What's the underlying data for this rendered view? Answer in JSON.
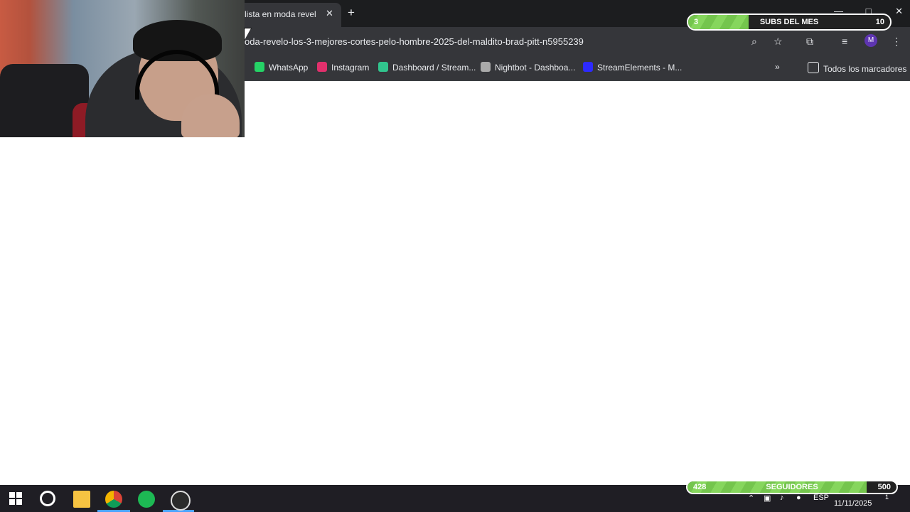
{
  "browser": {
    "tab_title": "lista en moda reveló",
    "url": "oda-revelo-los-3-mejores-cortes-pelo-hombre-2025-del-maldito-brad-pitt-n5955239",
    "avatar_letter": "M",
    "bookmarks": [
      "WhatsApp",
      "Instagram",
      "Dashboard / Stream...",
      "Nightbot - Dashboa...",
      "StreamElements - M..."
    ],
    "all_bookmarks": "Todos los marcadores"
  },
  "overlays": {
    "subs": {
      "current": "3",
      "title": "SUBS DEL MES",
      "goal": "10",
      "progress_fraction": 0.3
    },
    "followers": {
      "current": "428",
      "title": "SEGUIDORES",
      "goal": "500",
      "progress_fraction": 0.856
    }
  },
  "taskbar": {
    "language": "ESP",
    "date": "11/11/2025",
    "notification_count": "1"
  },
  "colors": {
    "browser_dark": "#35363a",
    "progress_green": "#74c54d",
    "taskbar": "#1f1e24"
  }
}
